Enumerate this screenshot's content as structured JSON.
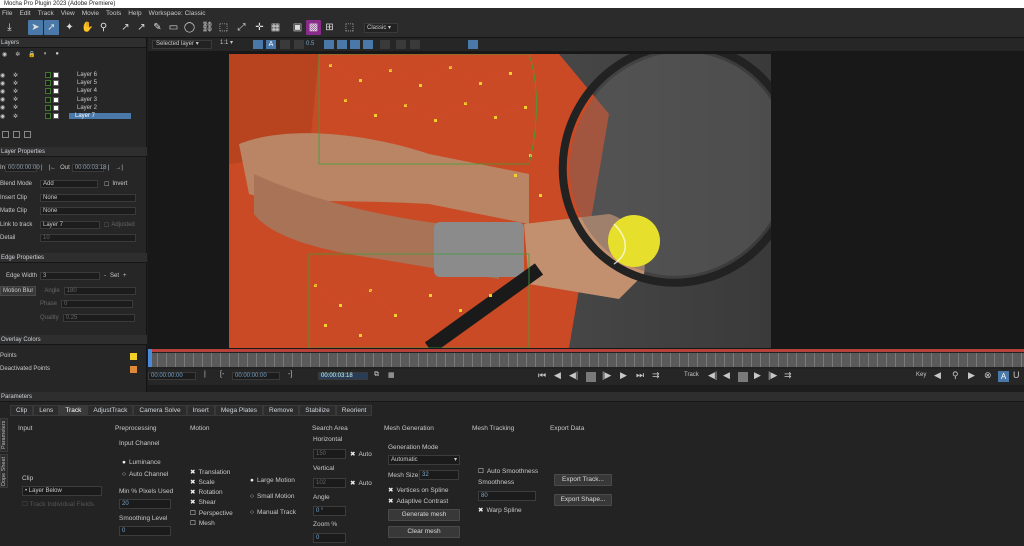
{
  "title": "Mocha Pro Plugin 2023 (Adobe Premiere)",
  "menu": [
    "File",
    "Edit",
    "Track",
    "View",
    "Movie",
    "Tools",
    "Help",
    "Workspace: Classic"
  ],
  "toolbar": {
    "workspace_select": "Classic"
  },
  "toolbar2": {
    "layer_select": "Selected layer",
    "zoom": "1:1",
    "value": "0.5"
  },
  "layers_panel": {
    "title": "Layers",
    "layers": [
      {
        "name": "Layer 6",
        "color": "#3c7a2a",
        "selected": false
      },
      {
        "name": "Layer 5",
        "color": "#3c7a2a",
        "selected": false
      },
      {
        "name": "Layer 4",
        "color": "#3c7a2a",
        "selected": false
      },
      {
        "name": "Layer 3",
        "color": "#3c7a2a",
        "selected": false
      },
      {
        "name": "Layer 2",
        "color": "#3c7a2a",
        "selected": false
      },
      {
        "name": "Layer 7",
        "color": "#3c7a2a",
        "selected": true
      }
    ]
  },
  "layer_properties": {
    "title": "Layer Properties",
    "in_label": "In",
    "in_value": "00:00:00:00",
    "out_label": "Out",
    "out_value": "00:00:03:18",
    "blend_mode_label": "Blend Mode",
    "blend_mode_value": "Add",
    "invert_label": "Invert",
    "insert_clip_label": "Insert Clip",
    "insert_clip_value": "None",
    "matte_clip_label": "Matte Clip",
    "matte_clip_value": "None",
    "link_to_track_label": "Link to track",
    "link_to_track_value": "Layer 7",
    "adjusted_label": "Adjusted",
    "detail_label": "Detail",
    "detail_value": "10"
  },
  "edge_properties": {
    "title": "Edge Properties",
    "edge_width_label": "Edge Width",
    "edge_width_value": "3",
    "set_label": "Set",
    "motion_blur_label": "Motion Blur",
    "angle_label": "Angle",
    "angle_value": "180",
    "phase_label": "Phase",
    "phase_value": "0",
    "quality_label": "Quality",
    "quality_value": "0.25"
  },
  "overlay_colors": {
    "title": "Overlay Colors",
    "points_label": "Points",
    "points_color": "#f2d02a",
    "deactivated_label": "Deactivated Points",
    "deactivated_color": "#e0883a"
  },
  "timeline": {
    "start": "00:00:00:00",
    "in_point": "00:00:00:00",
    "out_point": "00:00:03:18",
    "track_label": "Track",
    "key_label": "Key"
  },
  "parameters": {
    "title": "Parameters",
    "tabs": [
      "Clip",
      "Lens",
      "Track",
      "AdjustTrack",
      "Camera Solve",
      "Insert",
      "Mega Plates",
      "Remove",
      "Stabilize",
      "Reorient"
    ],
    "active_tab": "Track",
    "side_tabs": [
      "Parameters",
      "Dope Sheet"
    ],
    "input": {
      "title": "Input",
      "clip_label": "Clip",
      "clip_value": "Layer Below",
      "track_individual_fields": "Track Individual Fields"
    },
    "preprocessing": {
      "title": "Preprocessing",
      "input_channel": "Input Channel",
      "luminance": "Luminance",
      "auto_channel": "Auto Channel",
      "min_pixels_used": "Min % Pixels Used",
      "min_pixels_value": "20",
      "smoothing_level": "Smoothing Level",
      "smoothing_value": "0"
    },
    "motion": {
      "title": "Motion",
      "translation": "Translation",
      "scale": "Scale",
      "rotation": "Rotation",
      "shear": "Shear",
      "perspective": "Perspective",
      "mesh": "Mesh",
      "large_motion": "Large Motion",
      "small_motion": "Small Motion",
      "manual_track": "Manual Track"
    },
    "search_area": {
      "title": "Search Area",
      "horizontal": "Horizontal",
      "horizontal_value": "150",
      "vertical": "Vertical",
      "vertical_value": "102",
      "auto": "Auto",
      "angle": "Angle",
      "angle_value": "0 °",
      "zoom": "Zoom %",
      "zoom_value": "0"
    },
    "mesh_generation": {
      "title": "Mesh Generation",
      "generation_mode": "Generation Mode",
      "generation_mode_value": "Automatic",
      "mesh_size": "Mesh Size",
      "mesh_size_value": "32",
      "vertices_on_spline": "Vertices on Spline",
      "adaptive_contrast": "Adaptive Contrast",
      "generate_mesh": "Generate mesh",
      "clear_mesh": "Clear mesh"
    },
    "mesh_tracking": {
      "title": "Mesh Tracking",
      "auto_smoothness": "Auto Smoothness",
      "smoothness": "Smoothness",
      "smoothness_value": "80",
      "warp_spline": "Warp Spline"
    },
    "export_data": {
      "title": "Export Data",
      "export_tracking": "Export Track...",
      "export_shape": "Export Shape..."
    }
  },
  "icons": [
    "arrow-icon",
    "pointer-icon",
    "hand-icon",
    "zoom-icon",
    "pen-icon",
    "rect-icon",
    "circle-icon",
    "eye-icon",
    "gear-icon",
    "lock-icon",
    "play-icon"
  ]
}
